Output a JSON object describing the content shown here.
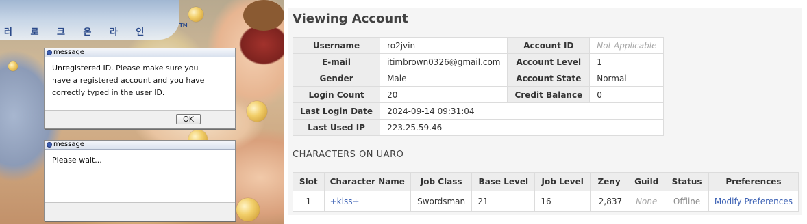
{
  "game": {
    "logo_text": "러 로 크 온 라 인",
    "logo_tm": "TM",
    "dialogs": [
      {
        "title": "message",
        "body": "Unregistered ID. Please make sure you\nhave a registered account and you have\ncorrectly typed in the user ID.",
        "ok_label": "OK"
      },
      {
        "title": "message",
        "body": "Please wait..."
      }
    ]
  },
  "account": {
    "page_title": "Viewing Account",
    "rows": [
      [
        "Username",
        "ro2jvin",
        "Account ID",
        "Not Applicable"
      ],
      [
        "E-mail",
        "itimbrown0326@gmail.com",
        "Account Level",
        "1"
      ],
      [
        "Gender",
        "Male",
        "Account State",
        "Normal"
      ],
      [
        "Login Count",
        "20",
        "Credit Balance",
        "0"
      ],
      [
        "Last Login Date",
        "2024-09-14 09:31:04"
      ],
      [
        "Last Used IP",
        "223.25.59.46"
      ]
    ]
  },
  "characters": {
    "section_title": "CHARACTERS ON UARO",
    "columns": [
      "Slot",
      "Character Name",
      "Job Class",
      "Base Level",
      "Job Level",
      "Zeny",
      "Guild",
      "Status",
      "Preferences"
    ],
    "rows": [
      {
        "slot": "1",
        "name": "+kiss+",
        "job_class": "Swordsman",
        "base_level": "21",
        "job_level": "16",
        "zeny": "2,837",
        "guild": "None",
        "status": "Offline",
        "preferences": "Modify Preferences"
      }
    ]
  },
  "colors": {
    "link": "#3d62b4",
    "muted": "#a8a8a8",
    "panel_bg": "#f5f5f5",
    "label_bg": "#ededed"
  }
}
